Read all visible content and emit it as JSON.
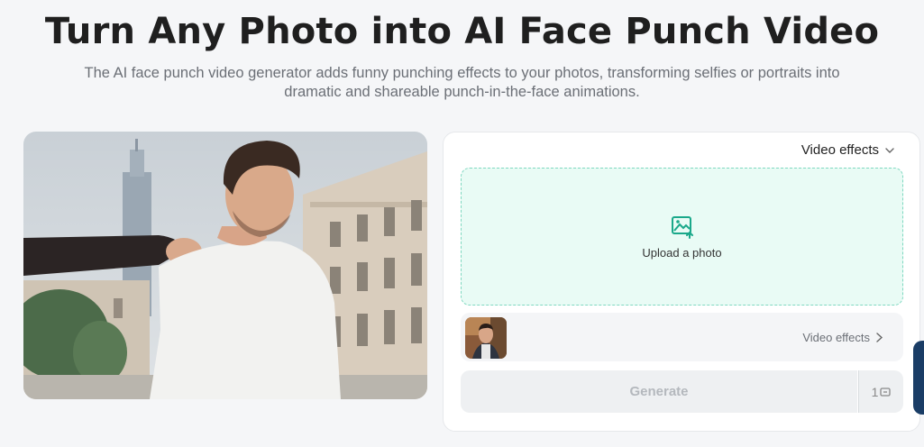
{
  "header": {
    "title": "Turn Any Photo into AI Face Punch Video",
    "subtitle": "The AI face punch video generator adds funny punching effects to your photos, transforming selfies or portraits into dramatic and shareable punch-in-the-face animations."
  },
  "panel": {
    "effects_dropdown_label": "Video effects",
    "upload_label": "Upload a photo",
    "effect_row_label": "Video effects",
    "generate_label": "Generate",
    "credits": "1"
  },
  "colors": {
    "upload_bg": "#e9fbf5",
    "upload_border": "#7fd8c0",
    "accent": "#1aa88a",
    "side_tab": "#1a3d66"
  },
  "icons": [
    "chevron-down-icon",
    "image-upload-icon",
    "chevron-right-icon",
    "credit-icon"
  ]
}
